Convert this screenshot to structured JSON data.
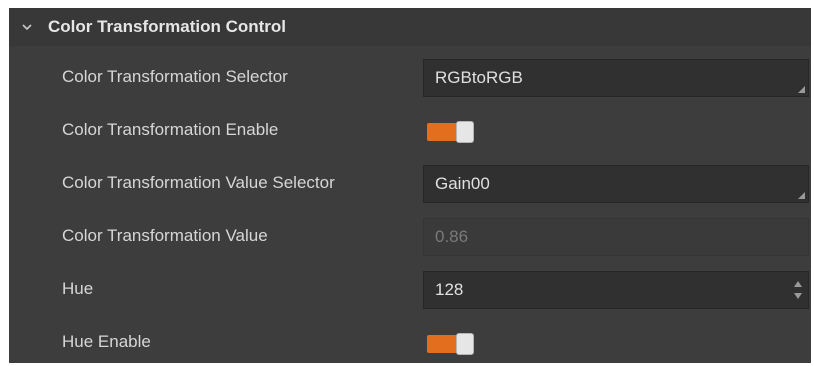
{
  "group": {
    "title": "Color Transformation Control",
    "icon": "chevron-down-icon"
  },
  "rows": [
    {
      "label": "Color Transformation Selector",
      "value": "RGBtoRGB",
      "control": "dropdown"
    },
    {
      "label": "Color Transformation Enable",
      "value": "on",
      "control": "toggle"
    },
    {
      "label": "Color Transformation Value Selector",
      "value": "Gain00",
      "control": "dropdown"
    },
    {
      "label": "Color Transformation Value",
      "value": "0.86",
      "control": "disabled-input"
    },
    {
      "label": "Hue",
      "value": "128",
      "control": "spinbox"
    },
    {
      "label": "Hue Enable",
      "value": "on",
      "control": "toggle"
    }
  ],
  "colors": {
    "panel_bg": "#3d3d3d",
    "field_bg": "#303030",
    "toggle_accent": "#e36f1e",
    "label_text": "#d6d6d6"
  }
}
